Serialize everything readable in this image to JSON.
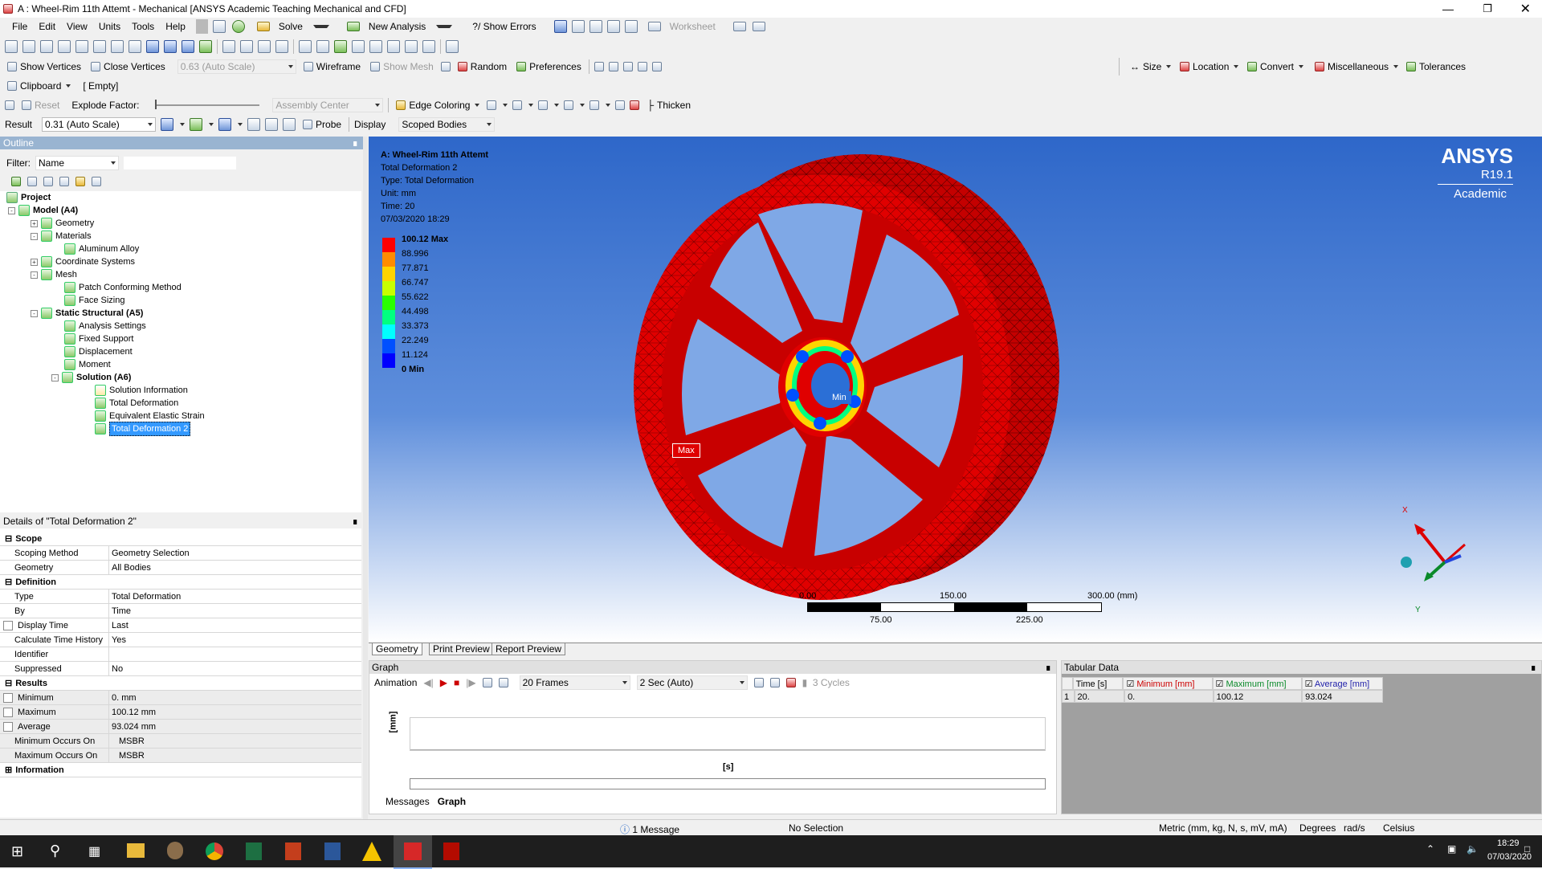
{
  "window": {
    "title": "A : Wheel-Rim 11th Attemt - Mechanical [ANSYS Academic Teaching Mechanical and CFD]"
  },
  "menu": [
    "File",
    "Edit",
    "View",
    "Units",
    "Tools",
    "Help"
  ],
  "toolbar1": {
    "solve": "Solve",
    "new_analysis": "New Analysis",
    "show_errors": "?/ Show Errors",
    "worksheet": "Worksheet"
  },
  "toolbar2": {},
  "toolbar3": {
    "show_vertices": "Show Vertices",
    "close_vertices": "Close Vertices",
    "scale": "0.63 (Auto Scale)",
    "wireframe": "Wireframe",
    "show_mesh": "Show Mesh",
    "random": "Random",
    "preferences": "Preferences",
    "size": "Size",
    "location": "Location",
    "convert": "Convert",
    "miscellaneous": "Miscellaneous",
    "tolerances": "Tolerances"
  },
  "toolbar4": {
    "clipboard": "Clipboard",
    "clip_value": "[ Empty]"
  },
  "toolbar5": {
    "reset": "Reset",
    "explode_factor": "Explode Factor:",
    "assembly_center": "Assembly Center",
    "edge_coloring": "Edge Coloring",
    "thicken": "Thicken"
  },
  "toolbar6": {
    "result_label": "Result",
    "result_scale": "0.31 (Auto Scale)",
    "probe": "Probe",
    "display_label": "Display",
    "display_value": "Scoped Bodies"
  },
  "outline": {
    "header": "Outline",
    "filter_label": "Filter:",
    "filter_value": "Name",
    "tree": {
      "project": "Project",
      "model": "Model (A4)",
      "geometry": "Geometry",
      "materials": "Materials",
      "aluminum": "Aluminum Alloy",
      "coordinate": "Coordinate Systems",
      "mesh": "Mesh",
      "patch": "Patch Conforming Method",
      "face_sizing": "Face Sizing",
      "static": "Static Structural (A5)",
      "analysis": "Analysis Settings",
      "fixed": "Fixed Support",
      "displacement": "Displacement",
      "moment": "Moment",
      "solution": "Solution (A6)",
      "sol_info": "Solution Information",
      "total_def": "Total Deformation",
      "elastic": "Equivalent Elastic Strain",
      "total_def2": "Total Deformation 2"
    }
  },
  "details": {
    "header": "Details of \"Total Deformation 2\"",
    "scope": "Scope",
    "scoping_method_k": "Scoping Method",
    "scoping_method_v": "Geometry Selection",
    "geometry_k": "Geometry",
    "geometry_v": "All Bodies",
    "definition": "Definition",
    "type_k": "Type",
    "type_v": "Total Deformation",
    "by_k": "By",
    "by_v": "Time",
    "display_time_k": "Display Time",
    "display_time_v": "Last",
    "calc_k": "Calculate Time History",
    "calc_v": "Yes",
    "identifier_k": "Identifier",
    "identifier_v": "",
    "suppressed_k": "Suppressed",
    "suppressed_v": "No",
    "results": "Results",
    "min_k": "Minimum",
    "min_v": "0. mm",
    "max_k": "Maximum",
    "max_v": "100.12 mm",
    "avg_k": "Average",
    "avg_v": "93.024 mm",
    "min_occ_k": "Minimum Occurs On",
    "min_occ_v": "MSBR",
    "max_occ_k": "Maximum Occurs On",
    "max_occ_v": "MSBR",
    "information": "Information"
  },
  "viewport": {
    "title": "A: Wheel-Rim 11th Attemt",
    "result": "Total Deformation 2",
    "type": "Type: Total Deformation",
    "unit": "Unit: mm",
    "time": "Time: 20",
    "date": "07/03/2020 18:29",
    "legend": [
      "100.12 Max",
      "88.996",
      "77.871",
      "66.747",
      "55.622",
      "44.498",
      "33.373",
      "22.249",
      "11.124",
      "0 Min"
    ],
    "legend_colors": [
      "#ff0000",
      "#ff8c00",
      "#ffd400",
      "#c8ff00",
      "#29ff00",
      "#00ff80",
      "#00ffff",
      "#00aaff",
      "#0050ff",
      "#0000ff"
    ],
    "brand": "ANSYS",
    "version": "R19.1",
    "edition": "Academic",
    "max_label": "Max",
    "min_label": "Min",
    "scale_top": [
      "0.00",
      "150.00",
      "300.00 (mm)"
    ],
    "scale_bottom": [
      "75.00",
      "225.00"
    ],
    "axis_x": "X",
    "axis_y": "Y"
  },
  "view_tabs": [
    "Geometry",
    "Print Preview",
    "Report Preview"
  ],
  "graph": {
    "header": "Graph",
    "animation": "Animation",
    "frames": "20 Frames",
    "duration": "2 Sec (Auto)",
    "cycles": "3 Cycles",
    "ylabel": "[mm]",
    "xlabel": "[s]",
    "tabs": [
      "Messages",
      "Graph"
    ]
  },
  "tabular": {
    "header": "Tabular Data",
    "cols": [
      "Time [s]",
      "Minimum [mm]",
      "Maximum [mm]",
      "Average [mm]"
    ],
    "row": [
      "1",
      "20.",
      "0.",
      "100.12",
      "93.024"
    ]
  },
  "status": {
    "messages": "1 Message",
    "selection": "No Selection",
    "units": "Metric (mm, kg, N, s, mV, mA)",
    "degrees": "Degrees",
    "rads": "rad/s",
    "temp": "Celsius"
  },
  "taskbar": {
    "time": "18:29",
    "date": "07/03/2020"
  }
}
